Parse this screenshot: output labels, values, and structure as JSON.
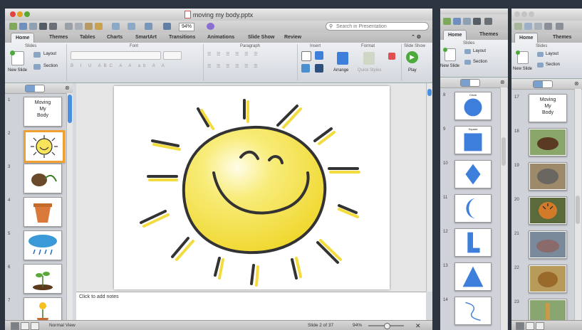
{
  "main_window": {
    "title": "moving my body.pptx",
    "zoom": "94%",
    "search_placeholder": "Search in Presentation",
    "tabs": [
      "Home",
      "Themes",
      "Tables",
      "Charts",
      "SmartArt",
      "Transitions",
      "Animations",
      "Slide Show",
      "Review"
    ],
    "ribbon": {
      "groups": [
        "Slides",
        "Font",
        "Paragraph",
        "Insert",
        "Format",
        "Slide Show"
      ],
      "new_slide": "New Slide",
      "layout": "Layout",
      "section": "Section",
      "arrange": "Arrange",
      "quick_styles": "Quick Styles",
      "play": "Play"
    },
    "thumbnails": [
      {
        "num": "1",
        "label": "Moving\nMy\nBody",
        "kind": "text"
      },
      {
        "num": "2",
        "kind": "sun"
      },
      {
        "num": "3",
        "kind": "seed"
      },
      {
        "num": "4",
        "kind": "pot"
      },
      {
        "num": "5",
        "kind": "rain"
      },
      {
        "num": "6",
        "kind": "sprout"
      },
      {
        "num": "7",
        "kind": "flower"
      }
    ],
    "notes_placeholder": "Click to add notes",
    "status": {
      "view": "Normal View",
      "slide": "Slide 2 of 37",
      "zoom": "94%"
    }
  },
  "middle_window": {
    "tabs": [
      "Home",
      "Themes"
    ],
    "ribbon": {
      "group": "Slides",
      "new_slide": "New Slide",
      "layout": "Layout",
      "section": "Section"
    },
    "thumbnails": [
      {
        "num": "8",
        "kind": "circle",
        "label": "Circle"
      },
      {
        "num": "9",
        "kind": "square",
        "label": "Square"
      },
      {
        "num": "10",
        "kind": "diamond"
      },
      {
        "num": "11",
        "kind": "crescent"
      },
      {
        "num": "12",
        "kind": "lshape"
      },
      {
        "num": "13",
        "kind": "triangle"
      },
      {
        "num": "14",
        "kind": "curve"
      }
    ]
  },
  "right_window": {
    "tabs": [
      "Home",
      "Themes"
    ],
    "ribbon": {
      "group": "Slides",
      "new_slide": "New Slide",
      "layout": "Layout",
      "section": "Section"
    },
    "thumbnails": [
      {
        "num": "17",
        "label": "Moving\nMy\nBody",
        "kind": "text"
      },
      {
        "num": "18",
        "kind": "bear"
      },
      {
        "num": "19",
        "kind": "elephant"
      },
      {
        "num": "20",
        "kind": "tiger"
      },
      {
        "num": "21",
        "kind": "hippo"
      },
      {
        "num": "22",
        "kind": "lion"
      },
      {
        "num": "23",
        "kind": "giraffe"
      }
    ]
  },
  "colors": {
    "accent": "#f0a030",
    "sun_yellow": "#f7e45a",
    "shape_blue": "#3f7fdc",
    "ribbon_bg": "#e4e7eb"
  }
}
